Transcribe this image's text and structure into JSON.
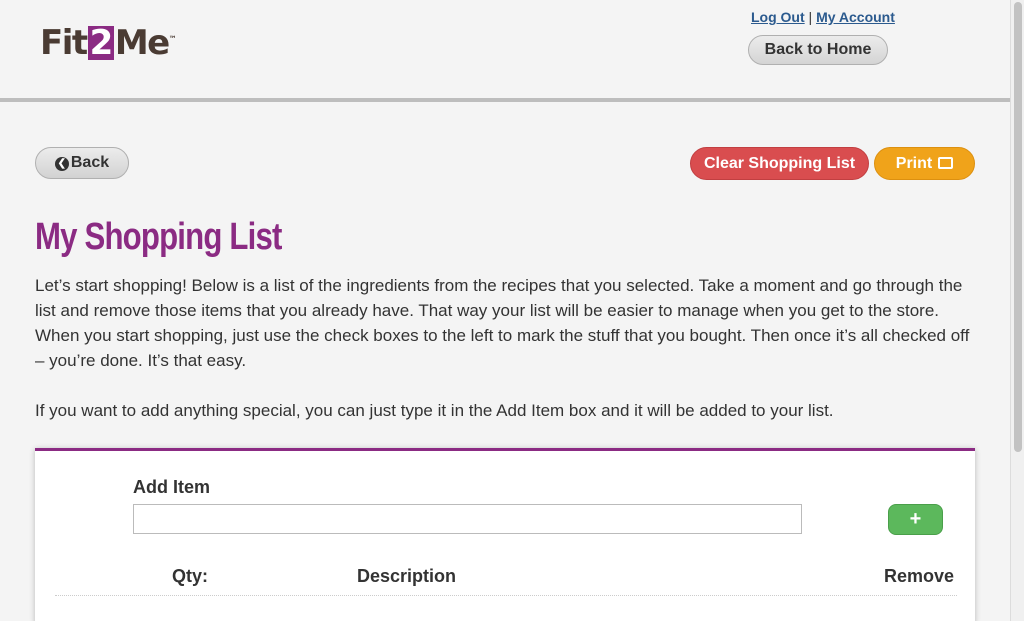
{
  "header": {
    "logo": {
      "part1": "Fit",
      "part2": "2",
      "part3": "Me",
      "mark": "™"
    },
    "links": {
      "logout": "Log Out",
      "separator": "|",
      "account": "My Account"
    },
    "home_button": "Back to Home"
  },
  "toolbar": {
    "back_label": "Back",
    "clear_label": "Clear Shopping List",
    "print_label": "Print"
  },
  "main": {
    "title": "My Shopping List",
    "intro": "Let’s start shopping! Below is a list of the ingredients from the recipes that you selected. Take a moment and go through the list and remove those items that you already have. That way your list will be easier to manage when you get to the store. When you start shopping, just use the check boxes to the left to mark the stuff that you bought. Then once it’s all checked off – you’re done. It’s that easy.",
    "intro2": "If you want to add anything special, you can just type it in the Add Item box and it will be added to your list."
  },
  "panel": {
    "add_label": "Add Item",
    "add_value": "",
    "add_button": "+",
    "columns": {
      "qty": "Qty:",
      "description": "Description",
      "remove": "Remove"
    }
  },
  "icons": {
    "back": "circle-chevron-left-icon",
    "print": "printer-icon",
    "add": "plus-icon"
  },
  "colors": {
    "brand_purple": "#8b2b83",
    "clear_red": "#d94d4f",
    "print_orange": "#f0a31a",
    "add_green": "#5cb85c",
    "logo_brown": "#4a3b33"
  }
}
